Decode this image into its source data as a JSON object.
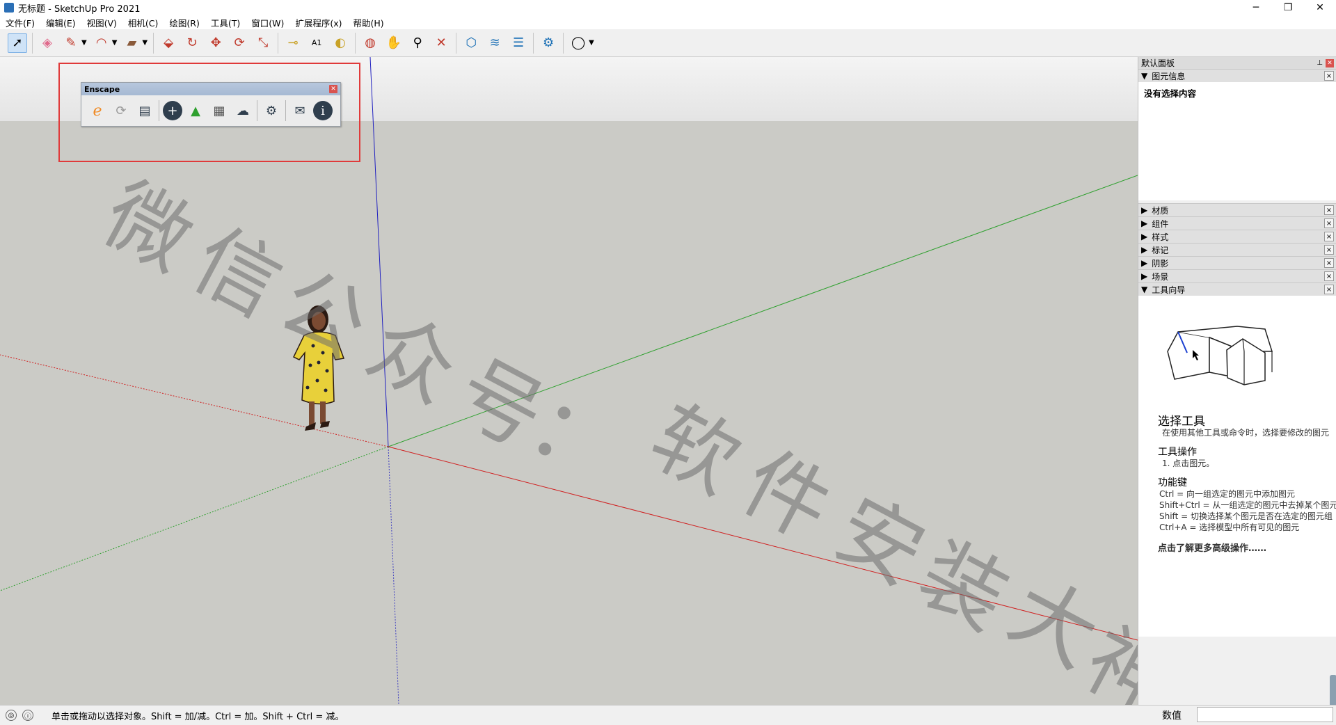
{
  "window": {
    "title": "无标题 - SketchUp Pro 2021",
    "minimize": "─",
    "maximize": "❐",
    "close": "✕"
  },
  "menu": [
    "文件(F)",
    "编辑(E)",
    "视图(V)",
    "相机(C)",
    "绘图(R)",
    "工具(T)",
    "窗口(W)",
    "扩展程序(x)",
    "帮助(H)"
  ],
  "toolbar": {
    "icons": [
      "select-icon",
      "eraser-icon",
      "pencil-icon",
      "arc-icon",
      "rectangle-icon",
      "push-pull-icon",
      "offset-icon",
      "move-icon",
      "rotate-icon",
      "scale-icon",
      "tape-measure-icon",
      "text-icon",
      "paint-bucket-icon",
      "orbit-icon",
      "pan-icon",
      "zoom-icon",
      "zoom-extents-icon",
      "warehouse-icon",
      "extension-warehouse-icon",
      "layout-icon",
      "extension-manager-icon",
      "account-icon"
    ]
  },
  "enscape": {
    "title": "Enscape",
    "close": "✕"
  },
  "watermark": [
    "微",
    "信",
    "公",
    "众",
    "号",
    "：",
    "软",
    "件",
    "安",
    "装",
    "大",
    "神"
  ],
  "panel": {
    "title": "默认面板",
    "pin": "📌",
    "close": "✕",
    "entity_info": {
      "label": "图元信息",
      "body": "没有选择内容"
    },
    "sections": [
      "材质",
      "组件",
      "样式",
      "标记",
      "阴影",
      "场景"
    ],
    "guide": {
      "label": "工具向导",
      "title": "选择工具",
      "desc": "在使用其他工具或命令时，选择要修改的图元",
      "op_heading": "工具操作",
      "op_1": "1. 点击图元。",
      "keys_heading": "功能键",
      "keys": [
        "Ctrl = 向一组选定的图元中添加图元",
        "Shift+Ctrl = 从一组选定的图元中去掉某个图元",
        "Shift = 切换选择某个图元是否在选定的图元组",
        "Ctrl+A = 选择模型中所有可见的图元"
      ],
      "link": "点击了解更多高级操作……"
    }
  },
  "status": {
    "message": "单击或拖动以选择对象。Shift = 加/减。Ctrl = 加。Shift + Ctrl = 减。",
    "vcb_label": "数值"
  }
}
